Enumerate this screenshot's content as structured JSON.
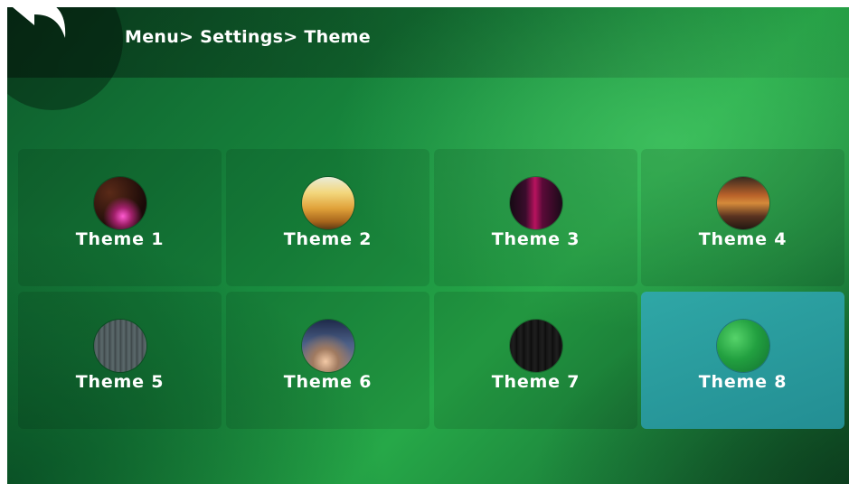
{
  "header": {
    "breadcrumb": "Menu> Settings> Theme",
    "back_icon": "back-arrow-icon"
  },
  "themes": [
    {
      "label": "Theme 1",
      "selected": false
    },
    {
      "label": "Theme 2",
      "selected": false
    },
    {
      "label": "Theme 3",
      "selected": false
    },
    {
      "label": "Theme 4",
      "selected": false
    },
    {
      "label": "Theme 5",
      "selected": false
    },
    {
      "label": "Theme 6",
      "selected": false
    },
    {
      "label": "Theme 7",
      "selected": false
    },
    {
      "label": "Theme 8",
      "selected": true
    }
  ],
  "colors": {
    "selected_tile": "#2a9a9a",
    "background_green": "#188a3e"
  }
}
